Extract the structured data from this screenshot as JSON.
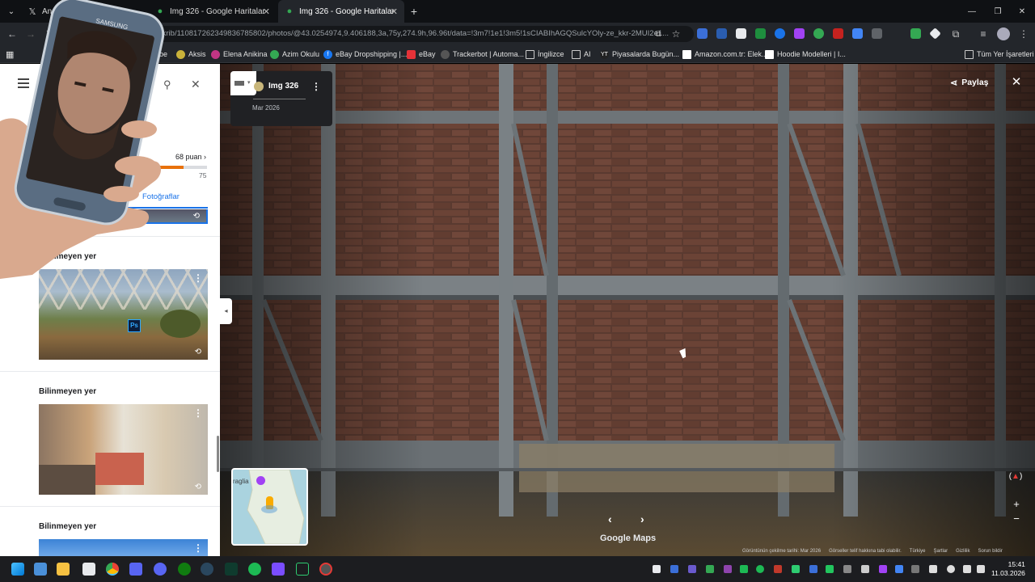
{
  "tabs": [
    {
      "title": "Anasayfa / X",
      "icon": "x-icon",
      "active": false
    },
    {
      "title": "Img 326 - Google Haritalar",
      "icon": "maps-pin-icon",
      "active": false
    },
    {
      "title": "Img 326 - Google Haritalar",
      "icon": "maps-pin-icon",
      "active": true
    }
  ],
  "url": "tkrib/110817262349836785802/photos/@43.0254974,9.406188,3a,75y,274.9h,96.96t/data=!3m7!1e1!3m5!1sCIABIhAGQSulcYOly-ze_kkr-2MUI2e1...",
  "bookmarks": {
    "aksis": "Aksis",
    "elena": "Elena Anikina",
    "azim": "Azim Okulu",
    "ebay_drop": "eBay Dropshipping |...",
    "ebay": "eBay",
    "trackerbot": "Trackerbot | Automa...",
    "ingilizce": "İngilizce",
    "ai": "AI",
    "piyasalarda": "Piyasalarda Bugün...",
    "amazon": "Amazon.com.tr: Elek...",
    "hoodie": "Hoodie Modelleri | I...",
    "all": "Tüm Yer İşaretleri",
    "partial_left": "ube"
  },
  "panel": {
    "points": "68 puan",
    "points_max": "75",
    "photos_tab": "Fotoğraflar",
    "cards": [
      {
        "title": "Bilinmeyen yer"
      },
      {
        "title": "Bilinmeyen yer"
      },
      {
        "title": "Bilinmeyen yer"
      }
    ],
    "ps_badge": "Ps"
  },
  "viewer": {
    "photo_title": "Img 326",
    "photo_date": "Mar 2026",
    "share_label": "Paylaş",
    "brand": "Google Maps",
    "minimap_label": "raglia",
    "footer": {
      "capture_date": "Görüntünün çekilme tarihi: Mar 2026",
      "copyright": "Görseller telif hakkına tabi olabilir.",
      "country": "Türkiye",
      "terms": "Şartlar",
      "privacy": "Gizlilik",
      "report": "Sorun bildir"
    }
  },
  "taskbar": {
    "time": "15:41",
    "date": "11.03.2026"
  },
  "phone": {
    "brand": "SAMSUNG"
  },
  "colors": {
    "tabstrip": "#0f1114",
    "toolbar": "#23262b",
    "accent_blue": "#1a73e8",
    "progress_orange": "#e8710a"
  }
}
